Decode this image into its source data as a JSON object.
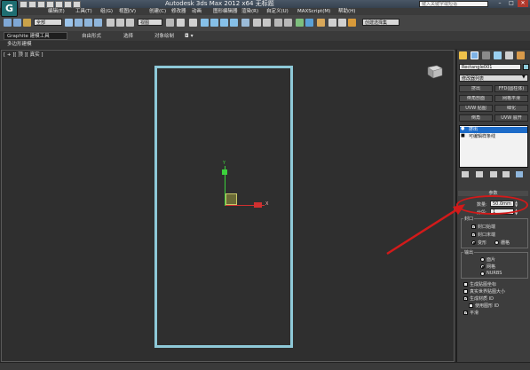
{
  "title": "Autodesk 3ds Max  2012 x64    无标题",
  "search": {
    "placeholder": "键入关键字或短语"
  },
  "menu": [
    "编辑(E)",
    "工具(T)",
    "组(G)",
    "视图(V)",
    "创建(C)",
    "修改器",
    "动画",
    "图形编辑器",
    "渲染(R)",
    "自定义(U)",
    "MAXScript(M)",
    "帮助(H)"
  ],
  "toolbar": {
    "filter": "全部",
    "ref_coord": "视图",
    "named_sel": "创建选择集"
  },
  "ribbon": {
    "tabs": [
      "Graphite 建模工具",
      "自由形式",
      "选择",
      "对象绘制"
    ],
    "sub": "多边形建模"
  },
  "viewport": {
    "label": "[ + ][ 顶 ][ 真实 ]"
  },
  "command_panel": {
    "object_name": "Rectangle001",
    "modifier_list": "修改器列表",
    "buttons": [
      "挤出",
      "FFD(圆柱体)",
      "倒角剖面",
      "网格平滑",
      "UVW 贴图",
      "细化",
      "倒角",
      "UVW 展开"
    ],
    "stack": [
      "挤出",
      "可编辑样条线"
    ],
    "params_title": "参数",
    "amount_label": "数量:",
    "amount_value": "50.0mm",
    "segments_label": "分段:",
    "segments_value": "1",
    "capping": {
      "title": "封口",
      "start": "封口始端",
      "end": "封口末端",
      "morph": "变形",
      "grid": "栅格"
    },
    "output": {
      "title": "输出",
      "patch": "面片",
      "mesh": "网格",
      "nurbs": "NURBS"
    },
    "gen_map": "生成贴图坐标",
    "real_world": "真实世界贴图大小",
    "gen_mat": "生成材质 ID",
    "use_shape": "使用图形 ID",
    "smooth": "平滑"
  },
  "colors": {
    "shape": "#8ec9d8",
    "annotation": "#d21a1a",
    "stack_selected": "#1c6bc8"
  }
}
